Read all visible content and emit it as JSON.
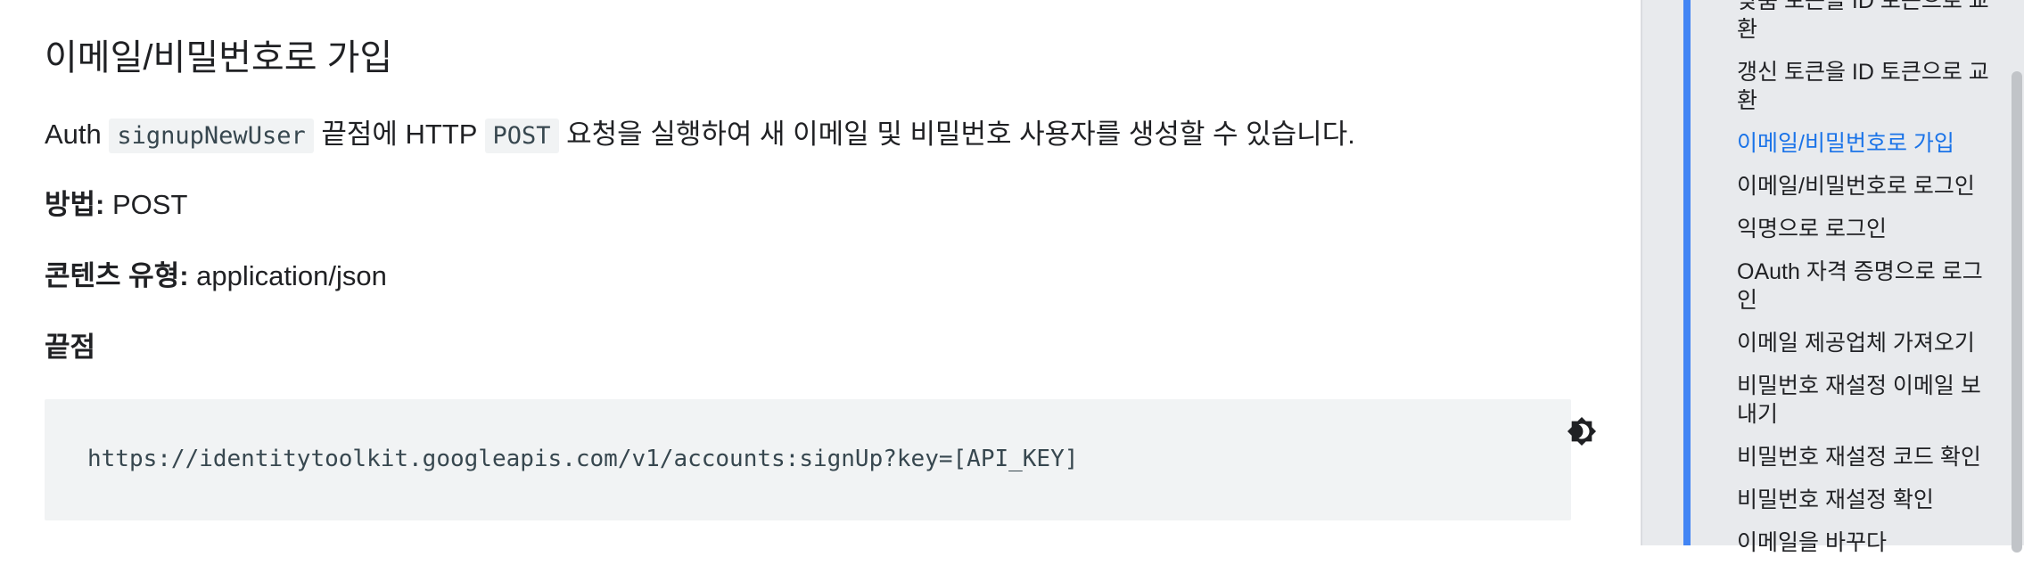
{
  "section": {
    "title": "이메일/비밀번호로 가입",
    "intro_before": "Auth ",
    "intro_code1": "signupNewUser",
    "intro_mid": " 끝점에 HTTP ",
    "intro_code2": "POST",
    "intro_after": " 요청을 실행하여 새 이메일 및 비밀번호 사용자를 생성할 수 있습니다.",
    "method_label": "방법:",
    "method_value": " POST",
    "content_type_label": "콘텐츠 유형:",
    "content_type_value": " application/json",
    "endpoint_heading": "끝점",
    "endpoint_url": "https://identitytoolkit.googleapis.com/v1/accounts:signUp?key=[API_KEY]",
    "icons": {
      "theme_toggle": "dark-mode-toggle-icon"
    }
  },
  "sidebar": {
    "accent_color": "#4285f4",
    "active_color": "#1a73e8",
    "items": [
      {
        "label": "맞춤 토큰을 ID 토큰으로 교환"
      },
      {
        "label": "갱신 토큰을 ID 토큰으로 교환"
      },
      {
        "label": "이메일/비밀번호로 가입",
        "active": true
      },
      {
        "label": "이메일/비밀번호로 로그인"
      },
      {
        "label": "익명으로 로그인"
      },
      {
        "label": "OAuth 자격 증명으로 로그인"
      },
      {
        "label": "이메일 제공업체 가져오기"
      },
      {
        "label": "비밀번호 재설정 이메일 보내기"
      },
      {
        "label": "비밀번호 재설정 코드 확인"
      },
      {
        "label": "비밀번호 재설정 확인"
      },
      {
        "label": "이메일을 바꾸다"
      }
    ]
  }
}
